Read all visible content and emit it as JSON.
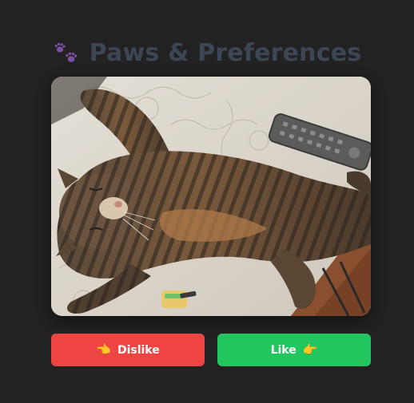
{
  "header": {
    "icon": "paw-prints-icon",
    "title": "Paws & Preferences"
  },
  "card": {
    "image": "photo-of-tabby-cat-sleeping-on-back"
  },
  "actions": {
    "dislike": {
      "icon": "pointing-left-hand-icon",
      "glyph": "👈",
      "label": "Dislike",
      "color": "#ef4444"
    },
    "like": {
      "label": "Like",
      "icon": "pointing-right-hand-icon",
      "glyph": "👉",
      "color": "#22c55e"
    }
  },
  "colors": {
    "background": "#222222",
    "title": "#3d4654",
    "paw": "#7b4fa3"
  }
}
